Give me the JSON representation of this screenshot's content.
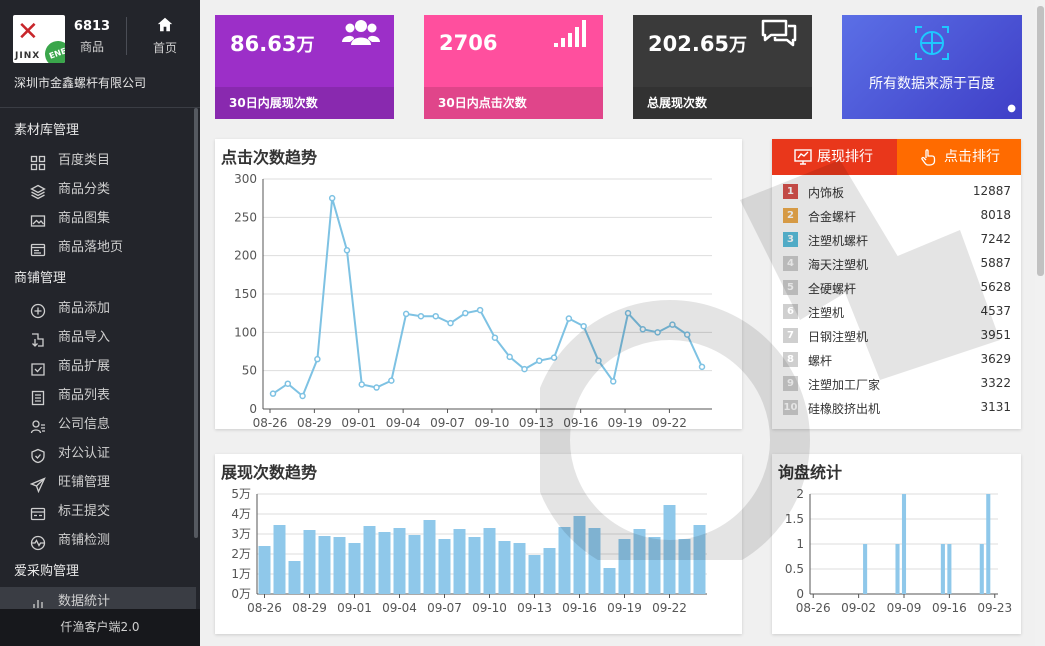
{
  "sidebar": {
    "logo_text": "JINX",
    "logo_badge": "ENE",
    "count": "6813",
    "count_label": "商品",
    "home_label": "首页",
    "company": "深圳市金鑫螺杆有限公司",
    "groups": [
      {
        "title": "素材库管理",
        "items": [
          {
            "label": "百度类目",
            "icon": "grid-icon"
          },
          {
            "label": "商品分类",
            "icon": "layers-icon"
          },
          {
            "label": "商品图集",
            "icon": "image-icon"
          },
          {
            "label": "商品落地页",
            "icon": "page-icon"
          }
        ]
      },
      {
        "title": "商铺管理",
        "items": [
          {
            "label": "商品添加",
            "icon": "plus-circle-icon"
          },
          {
            "label": "商品导入",
            "icon": "import-icon"
          },
          {
            "label": "商品扩展",
            "icon": "expand-icon"
          },
          {
            "label": "商品列表",
            "icon": "list-icon"
          },
          {
            "label": "公司信息",
            "icon": "user-info-icon"
          },
          {
            "label": "对公认证",
            "icon": "shield-icon"
          },
          {
            "label": "旺铺管理",
            "icon": "send-icon"
          },
          {
            "label": "标王提交",
            "icon": "submit-icon"
          },
          {
            "label": "商铺检测",
            "icon": "monitor-icon"
          }
        ]
      },
      {
        "title": "爱采购管理",
        "items": [
          {
            "label": "数据統计",
            "icon": "chart-icon"
          }
        ]
      }
    ],
    "footer": "仟渔客户端2.0"
  },
  "stats": [
    {
      "value": "86.63",
      "unit": "万",
      "label": "30日内展现次数",
      "icon": "users-icon",
      "color": "#9c2fc8"
    },
    {
      "value": "2706",
      "unit": "",
      "label": "30日内点击次数",
      "icon": "signal-icon",
      "color": "#ff4f9e"
    },
    {
      "value": "202.65",
      "unit": "万",
      "label": "总展现次数",
      "icon": "comments-icon",
      "color": "#3a3a3a"
    }
  ],
  "baidu_card": {
    "text": "所有数据来源于百度"
  },
  "click_chart": {
    "title": "点击次数趋势",
    "chart_data": {
      "type": "line",
      "title": "点击次数趋势",
      "x_ticks": [
        "08-26",
        "08-29",
        "09-01",
        "09-04",
        "09-07",
        "09-10",
        "09-13",
        "09-16",
        "09-19",
        "09-22"
      ],
      "y_ticks": [
        "0",
        "50",
        "100",
        "150",
        "200",
        "250",
        "300"
      ],
      "ylim": [
        0,
        300
      ],
      "values": [
        20,
        33,
        17,
        65,
        275,
        207,
        32,
        28,
        37,
        124,
        121,
        121,
        112,
        125,
        129,
        93,
        68,
        52,
        63,
        67,
        118,
        108,
        63,
        36,
        125,
        104,
        100,
        110,
        97,
        55
      ],
      "color": "#7ec2e3"
    }
  },
  "impression_chart": {
    "title": "展现次数趋势",
    "chart_data": {
      "type": "bar",
      "title": "展现次数趋势",
      "x_ticks": [
        "08-26",
        "08-29",
        "09-01",
        "09-04",
        "09-07",
        "09-10",
        "09-13",
        "09-16",
        "09-19",
        "09-22"
      ],
      "y_ticks": [
        "0万",
        "1万",
        "2万",
        "3万",
        "4万",
        "5万"
      ],
      "ylim": [
        0,
        50000
      ],
      "values": [
        24000,
        34500,
        16500,
        32000,
        29000,
        28500,
        25500,
        34000,
        31000,
        33000,
        29500,
        37000,
        27500,
        32500,
        28500,
        33000,
        26500,
        25500,
        19500,
        23000,
        33500,
        39000,
        33000,
        13000,
        27500,
        32500,
        28500,
        44500,
        27500,
        34500
      ],
      "color": "#8fc8ea"
    }
  },
  "inquiry_chart": {
    "title": "询盘统计",
    "chart_data": {
      "type": "bar",
      "title": "询盘统计",
      "x_ticks": [
        "08-26",
        "09-02",
        "09-09",
        "09-16",
        "09-23"
      ],
      "y_ticks": [
        "0",
        "0.5",
        "1",
        "1.5",
        "2"
      ],
      "ylim": [
        0,
        2
      ],
      "values": [
        0,
        0,
        0,
        0,
        0,
        0,
        0,
        0,
        1,
        0,
        0,
        0,
        0,
        1,
        2,
        0,
        0,
        0,
        0,
        0,
        1,
        1,
        0,
        0,
        0,
        0,
        1,
        2,
        0
      ],
      "color": "#8fc8ea"
    }
  },
  "rank": {
    "tab_active": "展现排行",
    "tab_other": "点击排行",
    "rows": [
      {
        "rank": "1",
        "name": "内饰板",
        "count": "12887",
        "color": "#d9534f"
      },
      {
        "rank": "2",
        "name": "合金螺杆",
        "count": "8018",
        "color": "#f0ad4e"
      },
      {
        "rank": "3",
        "name": "注塑机螺杆",
        "count": "7242",
        "color": "#5bc0de"
      },
      {
        "rank": "4",
        "name": "海天注塑机",
        "count": "5887",
        "color": "#cfcfcf"
      },
      {
        "rank": "5",
        "name": "全硬螺杆",
        "count": "5628",
        "color": "#cfcfcf"
      },
      {
        "rank": "6",
        "name": "注塑机",
        "count": "4537",
        "color": "#cfcfcf"
      },
      {
        "rank": "7",
        "name": "日钢注塑机",
        "count": "3951",
        "color": "#cfcfcf"
      },
      {
        "rank": "8",
        "name": "螺杆",
        "count": "3629",
        "color": "#cfcfcf"
      },
      {
        "rank": "9",
        "name": "注塑加工厂家",
        "count": "3322",
        "color": "#cfcfcf"
      },
      {
        "rank": "10",
        "name": "硅橡胶挤出机",
        "count": "3131",
        "color": "#cfcfcf"
      }
    ]
  }
}
